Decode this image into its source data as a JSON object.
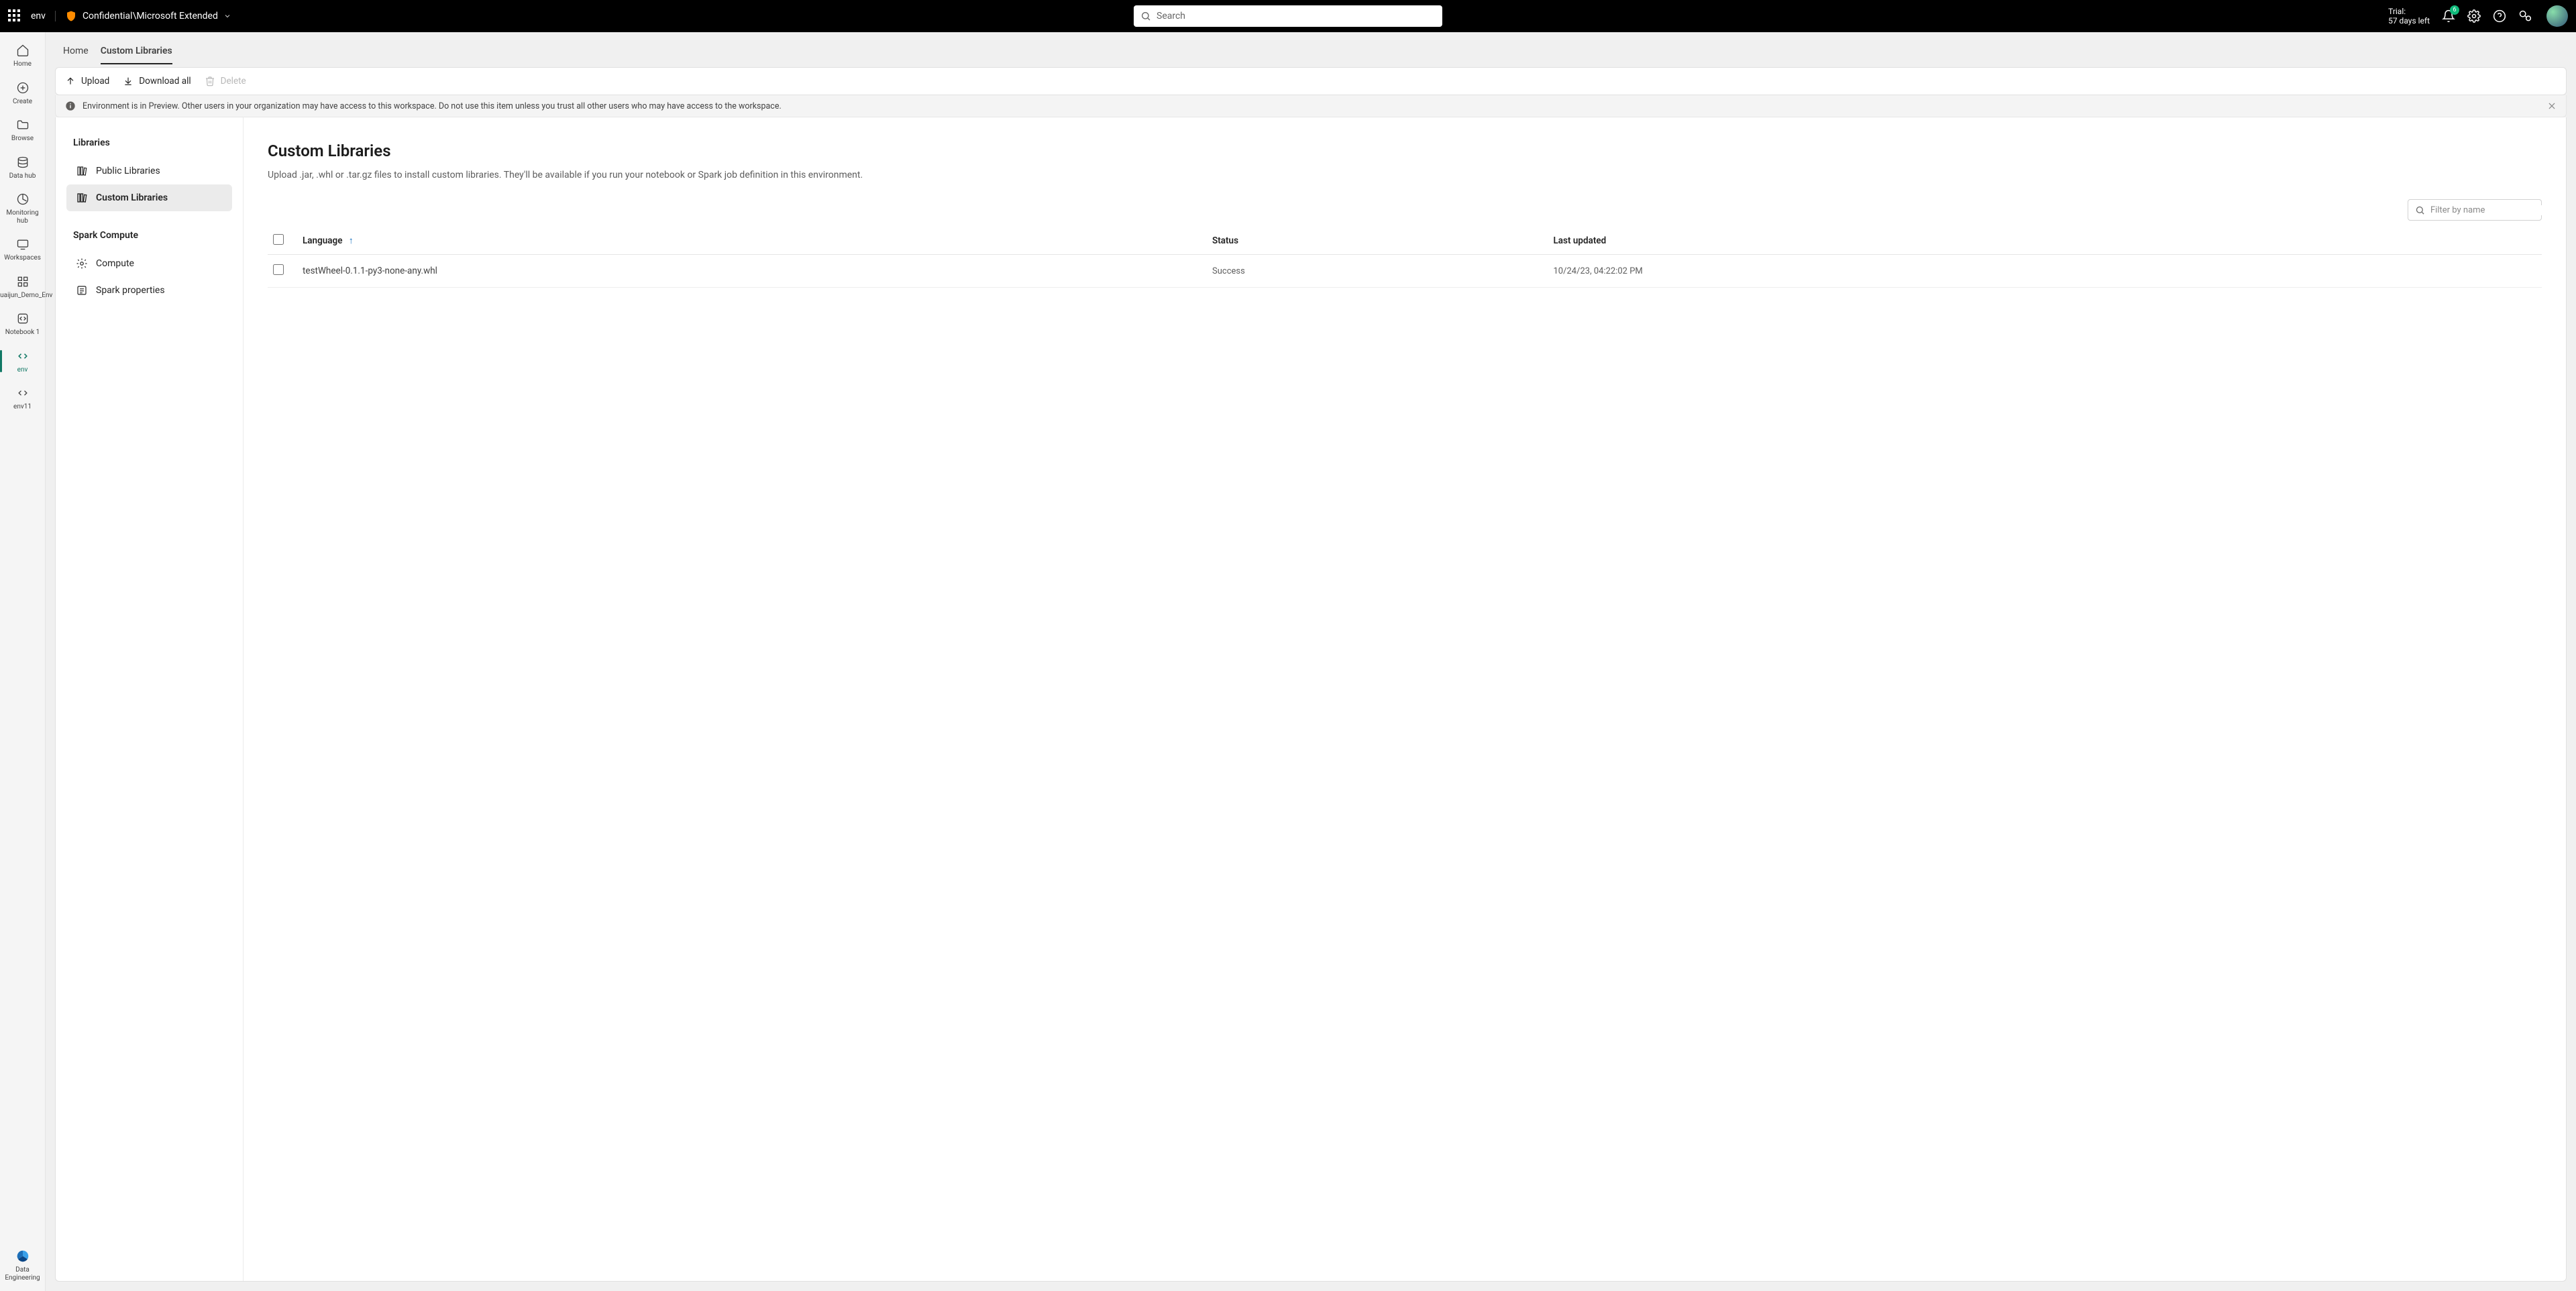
{
  "topbar": {
    "env_name": "env",
    "sensitivity_label": "Confidential\\Microsoft Extended",
    "search_placeholder": "Search",
    "trial_label": "Trial:",
    "trial_remaining": "57 days left",
    "notification_count": "6"
  },
  "rail": {
    "items": [
      {
        "label": "Home",
        "icon": "home"
      },
      {
        "label": "Create",
        "icon": "plus-circle"
      },
      {
        "label": "Browse",
        "icon": "folder"
      },
      {
        "label": "Data hub",
        "icon": "database"
      },
      {
        "label": "Monitoring hub",
        "icon": "monitor"
      },
      {
        "label": "Workspaces",
        "icon": "workspaces"
      },
      {
        "label": "Shuaijun_Demo_Env",
        "icon": "workspace-item"
      },
      {
        "label": "Notebook 1",
        "icon": "code-brackets"
      },
      {
        "label": "env",
        "icon": "code-brackets",
        "active": true
      },
      {
        "label": "env11",
        "icon": "code-brackets"
      }
    ],
    "bottom": {
      "label": "Data Engineering",
      "icon": "brand"
    }
  },
  "tabs": {
    "home": "Home",
    "custom": "Custom Libraries"
  },
  "toolbar": {
    "upload": "Upload",
    "download_all": "Download all",
    "delete": "Delete"
  },
  "banner": {
    "text": "Environment is in Preview. Other users in your organization may have access to this workspace. Do not use this item unless you trust all other users who may have access to the workspace."
  },
  "side": {
    "section_libraries": "Libraries",
    "public_libraries": "Public Libraries",
    "custom_libraries": "Custom Libraries",
    "section_spark": "Spark Compute",
    "compute": "Compute",
    "spark_properties": "Spark properties"
  },
  "detail": {
    "title": "Custom Libraries",
    "description": "Upload .jar, .whl or .tar.gz files to install custom libraries. They'll be available if you run your notebook or Spark job definition in this environment.",
    "filter_placeholder": "Filter by name",
    "columns": {
      "language": "Language",
      "status": "Status",
      "last_updated": "Last updated"
    },
    "rows": [
      {
        "name": "testWheel-0.1.1-py3-none-any.whl",
        "status": "Success",
        "updated": "10/24/23, 04:22:02 PM"
      }
    ]
  }
}
